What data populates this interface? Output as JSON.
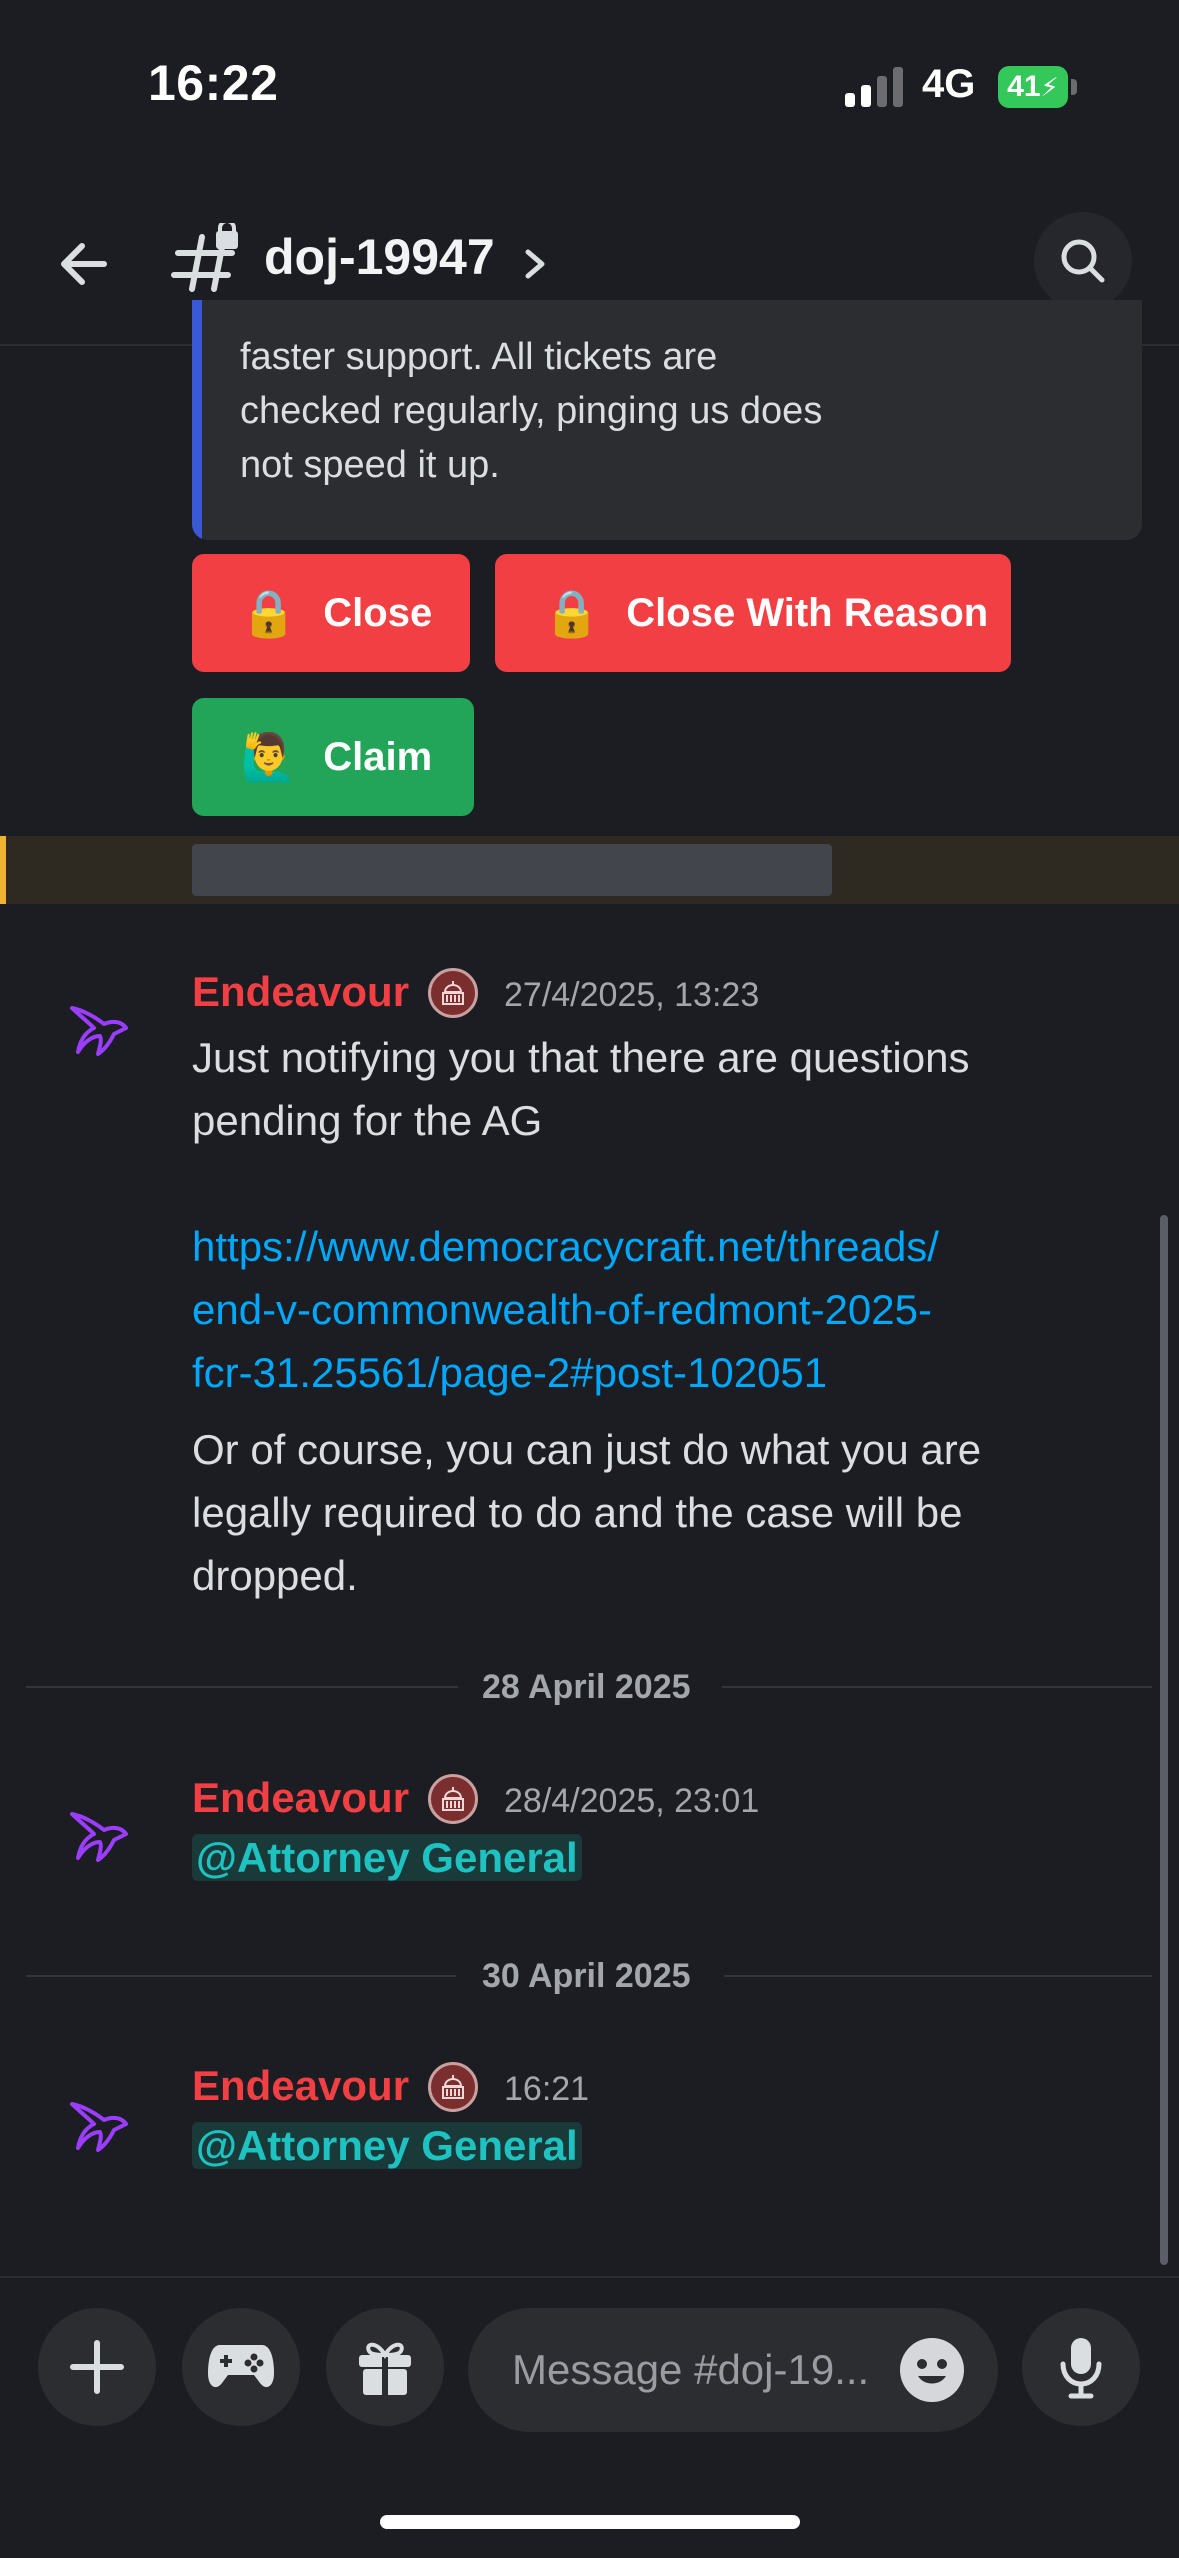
{
  "status": {
    "time": "16:22",
    "network": "4G",
    "battery": "41"
  },
  "header": {
    "channel": "doj-19947",
    "icons": [
      "back-arrow-icon",
      "locked-hash-icon",
      "chevron-right-icon",
      "search-icon"
    ]
  },
  "embed": {
    "lines": [
      "faster support. All tickets are",
      "checked regularly, pinging us does",
      "not speed it up."
    ]
  },
  "buttons": {
    "close": {
      "emoji": "🔒",
      "label": "Close"
    },
    "close_reason": {
      "emoji": "🔒",
      "label": "Close With Reason"
    },
    "claim": {
      "emoji": "🙋‍♂️",
      "label": "Claim"
    }
  },
  "messages": [
    {
      "author": "Endeavour",
      "timestamp": "27/4/2025, 13:23",
      "text_lines": [
        "Just notifying you that there are questions",
        "pending for the AG"
      ],
      "link_lines": [
        "https://www.democracycraft.net/threads/",
        "end-v-commonwealth-of-redmont-2025-",
        "fcr-31.25561/page-2#post-102051"
      ],
      "text2_lines": [
        "Or of course, you can just do what you are",
        "legally required to do and the case will be",
        "dropped."
      ]
    },
    {
      "author": "Endeavour",
      "timestamp": "28/4/2025, 23:01",
      "mention": "@Attorney General"
    },
    {
      "author": "Endeavour",
      "timestamp": "16:21",
      "mention": "@Attorney General"
    }
  ],
  "dividers": [
    "28 April 2025",
    "30 April 2025"
  ],
  "composer": {
    "placeholder": "Message #doj-19..."
  },
  "colors": {
    "accent_red": "#f23f43",
    "accent_green": "#23a559",
    "link": "#00a8fc",
    "mention": "#1ec2c0",
    "background": "#1c1d22"
  }
}
